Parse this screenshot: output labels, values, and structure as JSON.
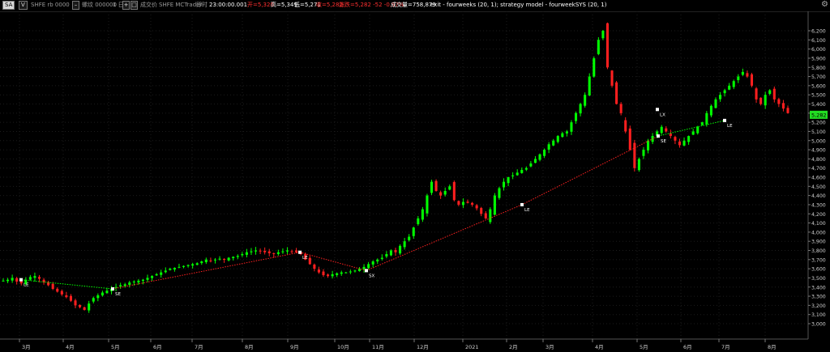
{
  "toolbar": {
    "symbol_btn": "SA",
    "mode_btn": "V",
    "exchange_symbol": "SHFE rb 0000",
    "minus_btn": "–",
    "code": "螺纹 000000",
    "interval": "1 日",
    "plus_btn": "+",
    "box_btn": "□",
    "sep": "成交价",
    "feed": "SHFE MCTrader",
    "realtime": "即时",
    "time": "23:00:00.001",
    "open": "开=5,320",
    "high": "高=5,349",
    "low": "低=5,271",
    "close": "收=5,282",
    "change": "涨跌=5,282 -52 -0.97%",
    "volume": "成交量=758,879",
    "strategy": "exit - fourweeks (20, 1); strategy model - fourweekSYS (20, 1)",
    "settings_icon": "gear-icon"
  },
  "price_axis": {
    "labels": [
      "6,200",
      "6,100",
      "6,000",
      "5,900",
      "5,800",
      "5,700",
      "5,600",
      "5,500",
      "5,400",
      "5,300",
      "5,200",
      "5,100",
      "5,000",
      "4,900",
      "4,800",
      "4,700",
      "4,600",
      "4,500",
      "4,400",
      "4,300",
      "4,200",
      "4,100",
      "4,000",
      "3,900",
      "3,800",
      "3,700",
      "3,600",
      "3,500",
      "3,400",
      "3,300",
      "3,200",
      "3,100",
      "3,000"
    ],
    "last_price": "5,282",
    "last_price_color": "#22dd22"
  },
  "time_axis": {
    "labels": [
      "3月",
      "4月",
      "5月",
      "6月",
      "7月",
      "8月",
      "9月",
      "10月",
      "11月",
      "12月",
      "2021",
      "2月",
      "3月",
      "4月",
      "5月",
      "6月",
      "7月",
      "8月"
    ]
  },
  "colors": {
    "up": "#00ff00",
    "down": "#ff1f1f",
    "grid": "#1c1c1c",
    "trade_line": "#ff2020",
    "label": "#ffffff"
  },
  "chart_data": {
    "type": "candlestick",
    "symbol": "SHFE rb 0000",
    "interval": "1 日",
    "ylim": [
      3000,
      6250
    ],
    "months": [
      "3月",
      "4月",
      "5月",
      "6月",
      "7月",
      "8月",
      "9月",
      "10月",
      "11月",
      "12月",
      "2021",
      "2月",
      "3月",
      "4月",
      "5月",
      "6月",
      "7月",
      "8月"
    ],
    "closes": [
      3470,
      3480,
      3500,
      3460,
      3440,
      3480,
      3510,
      3520,
      3490,
      3450,
      3420,
      3380,
      3350,
      3320,
      3290,
      3250,
      3200,
      3180,
      3150,
      3220,
      3280,
      3310,
      3340,
      3360,
      3380,
      3400,
      3420,
      3430,
      3450,
      3460,
      3470,
      3480,
      3500,
      3520,
      3540,
      3560,
      3580,
      3600,
      3610,
      3620,
      3630,
      3640,
      3650,
      3660,
      3680,
      3700,
      3690,
      3700,
      3710,
      3700,
      3720,
      3730,
      3740,
      3760,
      3780,
      3790,
      3800,
      3790,
      3780,
      3770,
      3760,
      3780,
      3790,
      3800,
      3790,
      3780,
      3760,
      3700,
      3650,
      3600,
      3560,
      3530,
      3520,
      3540,
      3550,
      3560,
      3560,
      3570,
      3580,
      3600,
      3620,
      3650,
      3680,
      3700,
      3720,
      3760,
      3800,
      3780,
      3850,
      3900,
      3950,
      4050,
      4150,
      4250,
      4400,
      4550,
      4450,
      4400,
      4450,
      4500,
      4350,
      4300,
      4330,
      4320,
      4300,
      4260,
      4200,
      4150,
      4250,
      4400,
      4480,
      4550,
      4600,
      4620,
      4650,
      4680,
      4700,
      4750,
      4800,
      4850,
      4900,
      4960,
      5000,
      5050,
      5080,
      5100,
      5200,
      5300,
      5400,
      5500,
      5700,
      5900,
      6100,
      6200,
      5800,
      5600,
      5400,
      5300,
      5100,
      4900,
      4700,
      4800,
      4900,
      5000,
      5050,
      5100,
      5150,
      5100,
      5050,
      5000,
      4950,
      5000,
      5050,
      5100,
      5150,
      5200,
      5300,
      5380,
      5450,
      5500,
      5550,
      5600,
      5650,
      5700,
      5750,
      5700,
      5600,
      5450,
      5400,
      5500,
      5550,
      5450,
      5400,
      5350,
      5300
    ],
    "trades": [
      {
        "label": "LE",
        "price": 3480
      },
      {
        "label": "SE",
        "price": 3380
      },
      {
        "label": "LE",
        "price": 3780
      },
      {
        "label": "SX",
        "price": 3580
      },
      {
        "label": "LE",
        "price": 4300
      },
      {
        "label": "LX",
        "price": 5340
      },
      {
        "label": "SE",
        "price": 5050
      },
      {
        "label": "LE",
        "price": 5220
      }
    ]
  }
}
